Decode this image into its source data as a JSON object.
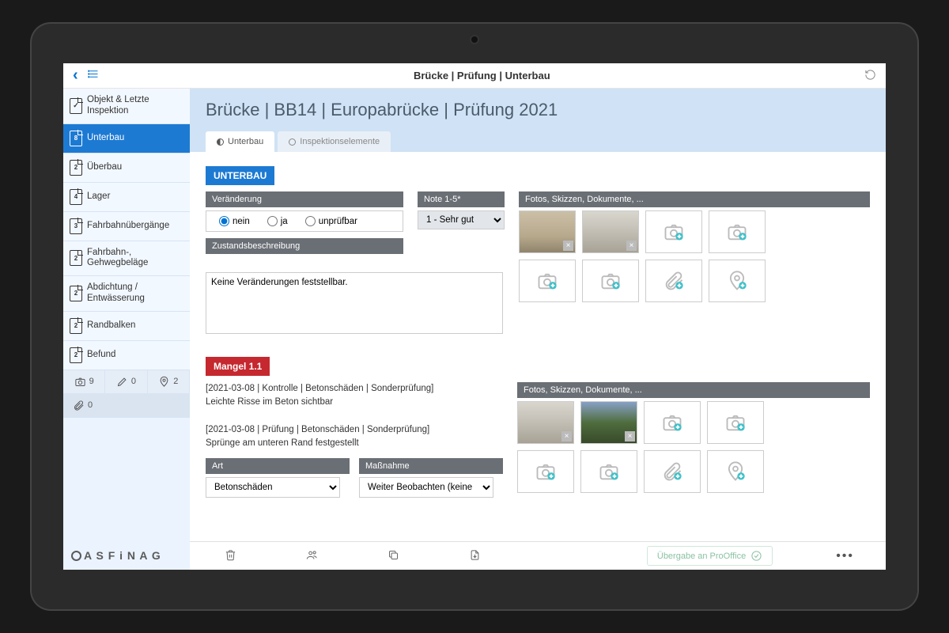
{
  "topbar": {
    "breadcrumb": "Brücke | Prüfung | Unterbau"
  },
  "page": {
    "title": "Brücke | BB14 | Europabrücke | Prüfung 2021"
  },
  "sidebar": {
    "items": [
      {
        "label": "Objekt & Letzte Inspektion",
        "badge": ""
      },
      {
        "label": "Unterbau",
        "badge": "8"
      },
      {
        "label": "Überbau",
        "badge": "2"
      },
      {
        "label": "Lager",
        "badge": "4"
      },
      {
        "label": "Fahrbahnübergänge",
        "badge": "3"
      },
      {
        "label": "Fahrbahn-, Gehwegbeläge",
        "badge": "2"
      },
      {
        "label": "Abdichtung / Entwässerung",
        "badge": "2"
      },
      {
        "label": "Randbalken",
        "badge": "2"
      },
      {
        "label": "Befund",
        "badge": "2"
      }
    ],
    "stats": {
      "photos": "9",
      "edits": "0",
      "pins": "2",
      "attachments": "0"
    },
    "brand": "A S F i N A G"
  },
  "tabs": {
    "t1": "Unterbau",
    "t2": "Inspektionselemente"
  },
  "unterbau": {
    "badge": "UNTERBAU",
    "veraenderung_label": "Veränderung",
    "opt_nein": "nein",
    "opt_ja": "ja",
    "opt_unpruefbar": "unprüfbar",
    "note_label": "Note 1-5*",
    "note_value": "1 - Sehr gut",
    "zustand_label": "Zustandsbeschreibung",
    "zustand_text": "Keine Veränderungen feststellbar.",
    "attach_label": "Fotos, Skizzen, Dokumente, ..."
  },
  "mangel": {
    "badge": "Mangel 1.1",
    "entry1_meta": "[2021-03-08 | Kontrolle | Betonschäden | Sonderprüfung]",
    "entry1_text": "Leichte Risse im Beton sichtbar",
    "entry2_meta": "[2021-03-08 | Prüfung | Betonschäden | Sonderprüfung]",
    "entry2_text": "Sprünge am unteren Rand festgestellt",
    "art_label": "Art",
    "art_value": "Betonschäden",
    "mass_label": "Maßnahme",
    "mass_value": "Weiter Beobachten (keine ...",
    "attach_label": "Fotos, Skizzen, Dokumente, ..."
  },
  "bottombar": {
    "transfer": "Übergabe an ProOffice"
  }
}
